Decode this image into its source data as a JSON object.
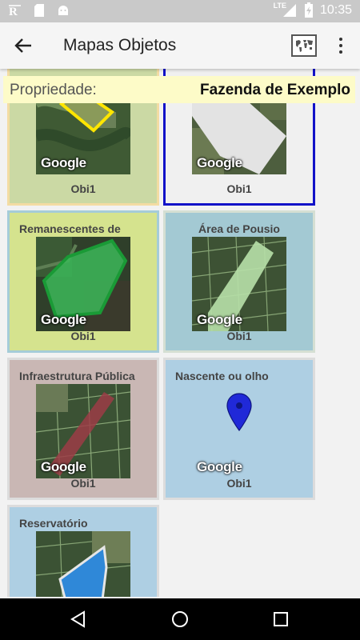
{
  "status_bar": {
    "time": "10:35",
    "network_label": "LTE",
    "icons": [
      "app-notification-icon",
      "sd-card-icon",
      "android-icon",
      "signal-icon",
      "battery-charging-icon"
    ]
  },
  "toolbar": {
    "title": "Mapas Objetos",
    "back_icon": "arrow-back-icon",
    "map_icon": "world-map-icon",
    "menu_icon": "more-vert-icon"
  },
  "property": {
    "label": "Propriedade:",
    "value": "Fazenda de Exemplo"
  },
  "cards": [
    {
      "title": "",
      "object": "Obi1",
      "google": "Google",
      "background": "#cbd9a4",
      "border": "#f3dca3",
      "shape": "polygon",
      "shape_color": "#ffe600"
    },
    {
      "title": "",
      "object": "Obi1",
      "google": "Google",
      "background": "#f0f0f0",
      "border": "#1212c8",
      "shape": "polygon",
      "shape_color": "#e3e3e3"
    },
    {
      "title": "Remanescentes de",
      "object": "Obi1",
      "google": "Google",
      "background": "#d5e38e",
      "border": "#a5ccd8",
      "shape": "polygon",
      "shape_color": "#2fb64b"
    },
    {
      "title": "Área de Pousio",
      "object": "Obi1",
      "google": "Google",
      "background": "#a3c9d3",
      "border": "#d5dfd3",
      "shape": "polygon",
      "shape_color": "#b7e0a8"
    },
    {
      "title": "Infraestrutura Pública",
      "object": "Obi1",
      "google": "Google",
      "background": "#c9b7b4",
      "border": "#dcdcdc",
      "shape": "polyline",
      "shape_color": "#9c3c46"
    },
    {
      "title": "Nascente ou olho",
      "object": "Obi1",
      "google": "Google",
      "background": "#aecfe3",
      "border": "#dcdcdc",
      "shape": "marker",
      "shape_color": "#2029d8"
    },
    {
      "title": "Reservatório",
      "object": "",
      "google": "",
      "background": "#aecfe3",
      "border": "#dcdcdc",
      "shape": "polygon",
      "shape_color": "#2f88d8"
    }
  ],
  "nav_bar": {
    "icons": [
      "nav-back-icon",
      "nav-home-icon",
      "nav-recents-icon"
    ]
  }
}
